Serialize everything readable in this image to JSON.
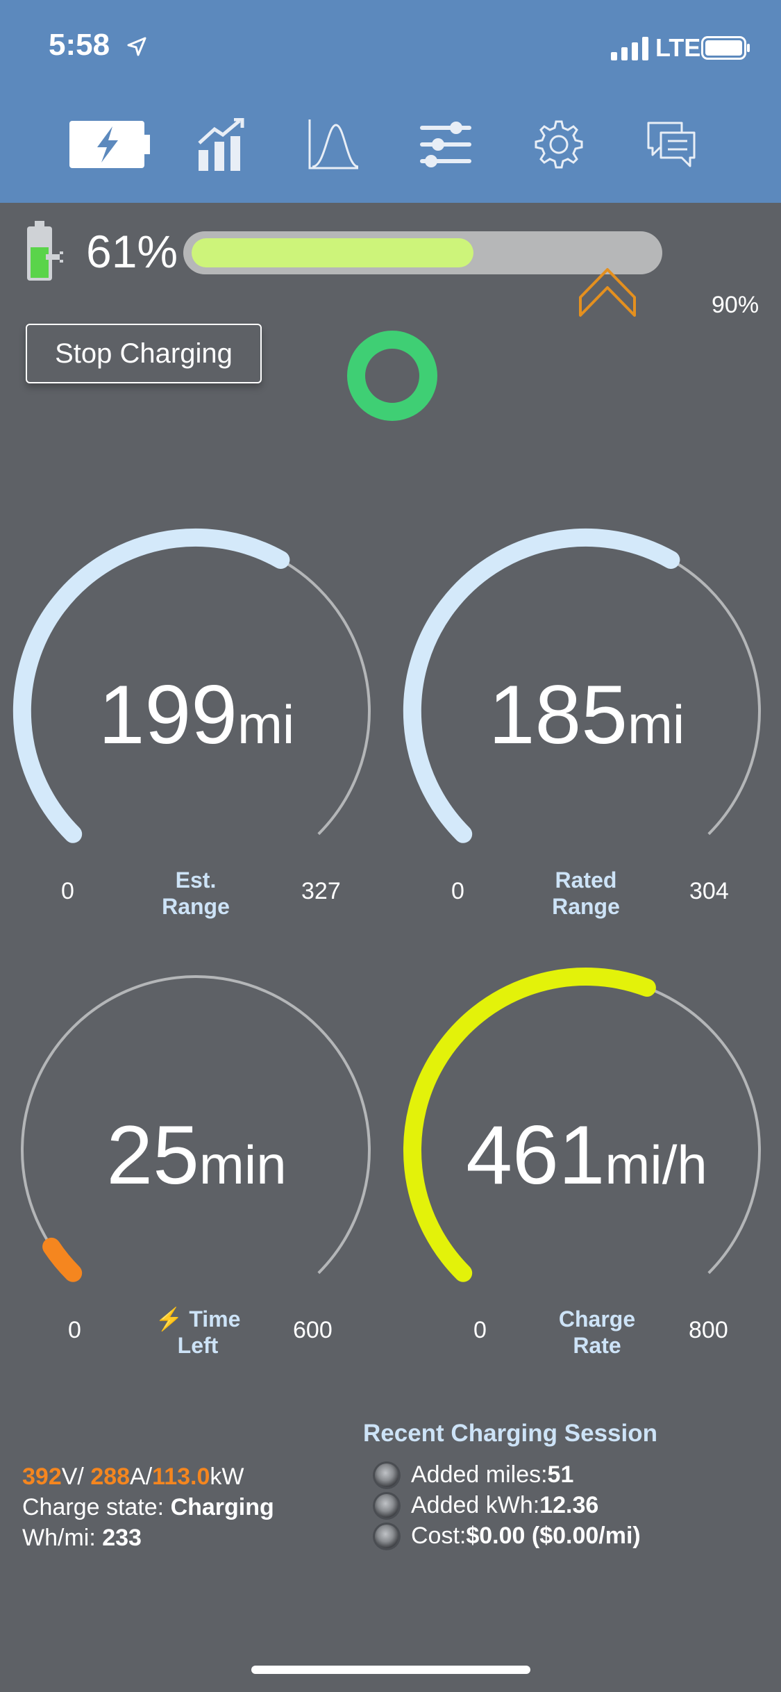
{
  "status_bar": {
    "time": "5:58",
    "network": "LTE"
  },
  "tabs": [
    {
      "name": "charging",
      "icon": "battery-bolt-icon",
      "active": true
    },
    {
      "name": "graphs",
      "icon": "bar-chart-icon"
    },
    {
      "name": "curve",
      "icon": "curve-chart-icon"
    },
    {
      "name": "controls",
      "icon": "sliders-icon"
    },
    {
      "name": "settings",
      "icon": "gear-icon"
    },
    {
      "name": "messages",
      "icon": "chat-bubbles-icon"
    }
  ],
  "battery": {
    "percent_label": "61%",
    "level": 0.61,
    "limit_label": "90%",
    "limit": 0.9
  },
  "stop_button": {
    "label": "Stop Charging"
  },
  "gauges": {
    "est_range": {
      "value": "199",
      "unit": "mi",
      "label1": "Est.",
      "label2": "Range",
      "min": "0",
      "max": "327"
    },
    "rated_range": {
      "value": "185",
      "unit": "mi",
      "label1": "Rated",
      "label2": "Range",
      "min": "0",
      "max": "304"
    },
    "time_left": {
      "value": "25",
      "unit": "min",
      "label1": "Time",
      "label2": "Left",
      "icon": "lightning-icon",
      "min": "0",
      "max": "600"
    },
    "charge_rate": {
      "value": "461",
      "unit": "mi/h",
      "label1": "Charge",
      "label2": "Rate",
      "min": "0",
      "max": "800"
    }
  },
  "electrical": {
    "volts": "392",
    "volts_unit": "V/ ",
    "amps": "288",
    "amps_unit": "A/",
    "kw": "113.0",
    "kw_unit": "kW",
    "charge_state_label": "Charge state: ",
    "charge_state": "Charging",
    "whmi_label": "Wh/mi: ",
    "whmi": "233"
  },
  "session": {
    "title": "Recent Charging Session",
    "rows": [
      {
        "label": "Added miles: ",
        "value": "51"
      },
      {
        "label": "Added kWh: ",
        "value": "12.36"
      },
      {
        "label": "Cost: ",
        "value": "$0.00 ($0.00/mi)"
      }
    ]
  },
  "colors": {
    "header": "#5c89bd",
    "background": "#5e6166",
    "range_arc": "#d4e9fa",
    "rate_arc": "#e3f20a",
    "time_arc": "#f5861f",
    "battery_fill": "#cdf47a",
    "ring": "#3fcf74",
    "label": "#cde3f7"
  }
}
